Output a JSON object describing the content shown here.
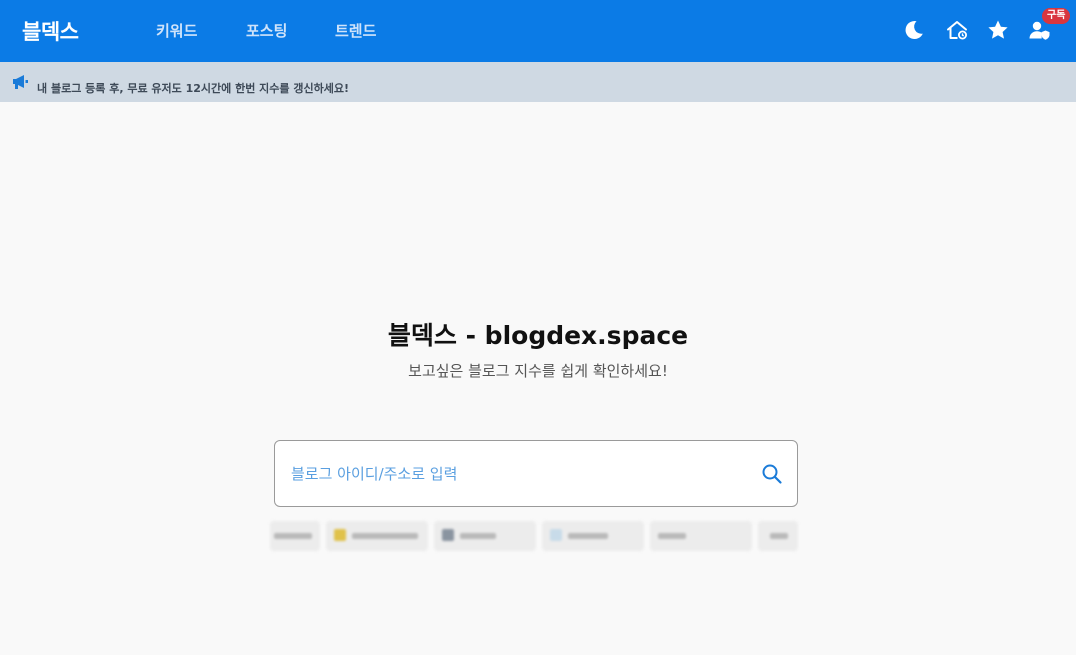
{
  "header": {
    "logo": "블덱스",
    "nav": [
      "키워드",
      "포스팅",
      "트렌드"
    ],
    "icons": [
      "moon-icon",
      "home-icon",
      "star-icon",
      "user-icon"
    ],
    "subscribe_badge": "구독",
    "color": "#0b7be6"
  },
  "notice": {
    "icon": "megaphone-icon",
    "text": "내 블로그 등록 후, 무료 유저도 12시간에 한번 지수를 갱신하세요!"
  },
  "hero": {
    "title": "블덱스 - blogdex.space",
    "subtitle": "보고싶은 블로그 지수를 쉽게 확인하세요!"
  },
  "search": {
    "placeholder": "블로그 아이디/주소로 입력",
    "value": ""
  },
  "recent_chips": [
    "",
    "",
    "",
    "",
    "",
    ""
  ]
}
